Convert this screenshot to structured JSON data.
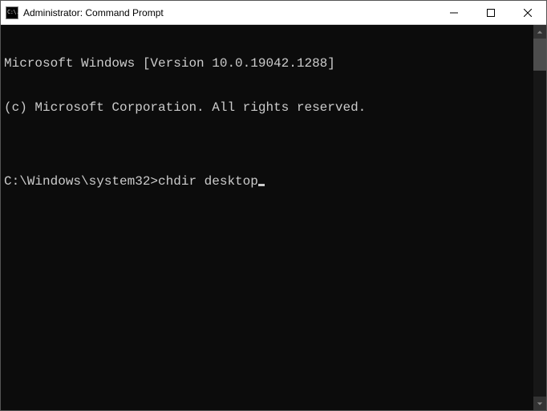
{
  "window": {
    "title": "Administrator: Command Prompt",
    "icon_label": "C:\\."
  },
  "terminal": {
    "line1": "Microsoft Windows [Version 10.0.19042.1288]",
    "line2": "(c) Microsoft Corporation. All rights reserved.",
    "blank": "",
    "prompt": "C:\\Windows\\system32>",
    "command": "chdir desktop"
  }
}
